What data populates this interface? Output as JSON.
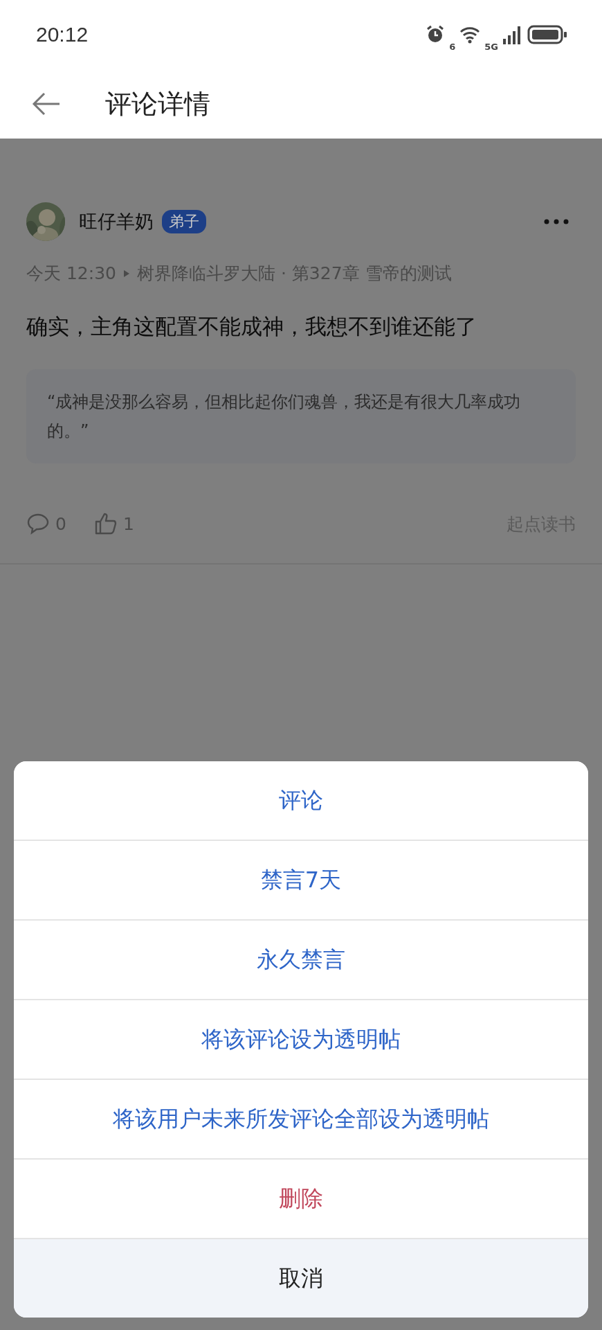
{
  "status_bar": {
    "time": "20:12",
    "wifi_label": "6",
    "network": "5G"
  },
  "header": {
    "title": "评论详情"
  },
  "comment": {
    "user": {
      "name": "旺仔羊奶",
      "badge": "弟子"
    },
    "time": "今天 12:30",
    "source": "树界降临斗罗大陆 · 第327章 雪帝的测试",
    "text": "确实，主角这配置不能成神，我想不到谁还能了",
    "quote": "“成神是没那么容易，但相比起你们魂兽，我还是有很大几率成功的。”",
    "reply_count": "0",
    "like_count": "1",
    "app_name": "起点读书"
  },
  "action_sheet": {
    "items": [
      {
        "label": "评论",
        "kind": "normal"
      },
      {
        "label": "禁言7天",
        "kind": "normal"
      },
      {
        "label": "永久禁言",
        "kind": "normal"
      },
      {
        "label": "将该评论设为透明帖",
        "kind": "normal"
      },
      {
        "label": "将该用户未来所发评论全部设为透明帖",
        "kind": "normal"
      },
      {
        "label": "删除",
        "kind": "danger"
      }
    ],
    "cancel": "取消"
  }
}
